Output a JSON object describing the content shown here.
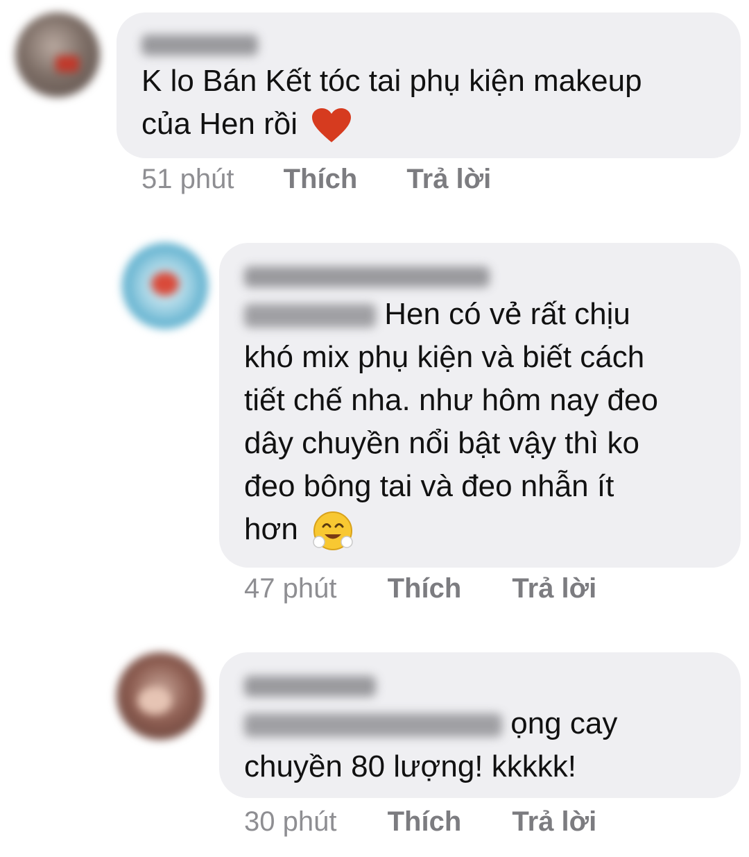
{
  "comments": [
    {
      "lines": [
        "K lo Bán Kết tóc tai phụ kiện makeup",
        "của Hen rồi"
      ],
      "emoji": "heart-emoji",
      "time": "51 phút",
      "like_label": "Thích",
      "reply_label": "Trả lời"
    },
    {
      "lines": [
        "Hen có vẻ rất chịu",
        "khó mix phụ kiện và biết cách",
        "tiết chế nha. như hôm nay đeo",
        "dây chuyền nổi bật vậy thì ko",
        "đeo bông tai và đeo nhẫn ít",
        "hơn"
      ],
      "emoji": "smiling-face-emoji",
      "time": "47 phút",
      "like_label": "Thích",
      "reply_label": "Trả lời"
    },
    {
      "lines": [
        "ọng cay",
        "chuyền 80 lượng! kkkkk!"
      ],
      "time": "30 phút",
      "like_label": "Thích",
      "reply_label": "Trả lời"
    }
  ],
  "colors": {
    "bubble": "#efeff2",
    "text": "#111111",
    "meta": "#8d8d91"
  }
}
